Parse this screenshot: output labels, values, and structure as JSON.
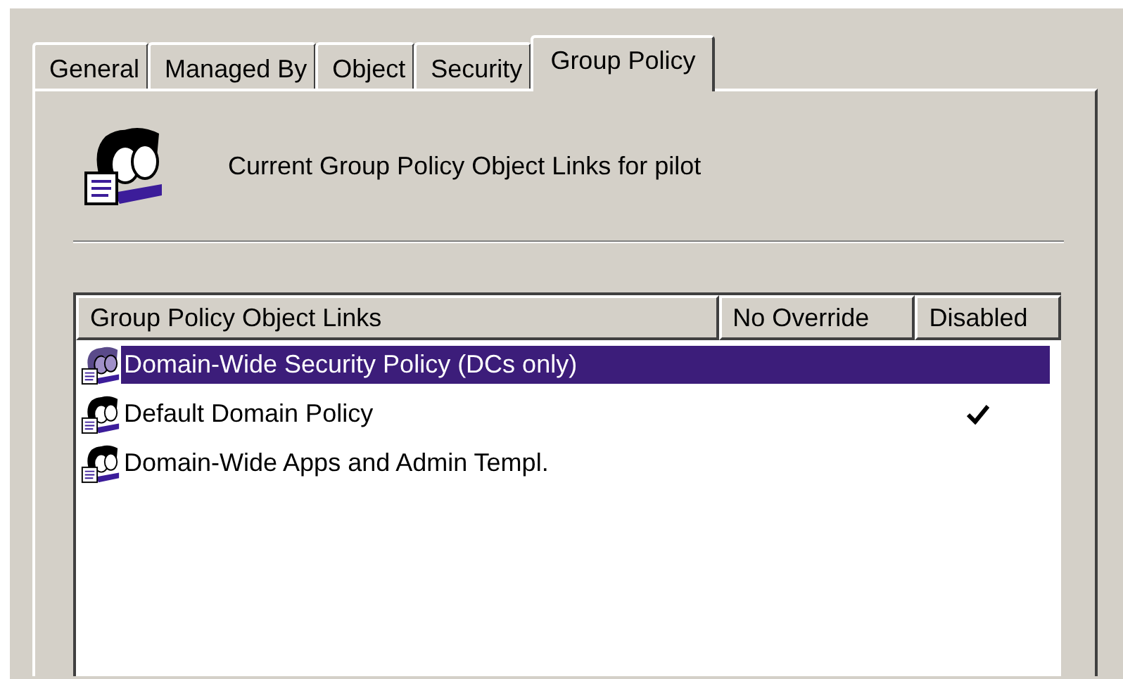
{
  "tabs": [
    {
      "label": "General",
      "selected": false
    },
    {
      "label": "Managed By",
      "selected": false
    },
    {
      "label": "Object",
      "selected": false
    },
    {
      "label": "Security",
      "selected": false
    },
    {
      "label": "Group Policy",
      "selected": true
    }
  ],
  "header": {
    "text": "Current Group Policy Object Links for pilot"
  },
  "list": {
    "columns": [
      "Group Policy Object Links",
      "No Override",
      "Disabled"
    ],
    "rows": [
      {
        "name": "Domain-Wide Security Policy (DCs only)",
        "no_override": false,
        "disabled": false,
        "selected": true
      },
      {
        "name": "Default Domain Policy",
        "no_override": false,
        "disabled": true,
        "selected": false
      },
      {
        "name": "Domain-Wide Apps and Admin Templ.",
        "no_override": false,
        "disabled": false,
        "selected": false
      }
    ]
  }
}
